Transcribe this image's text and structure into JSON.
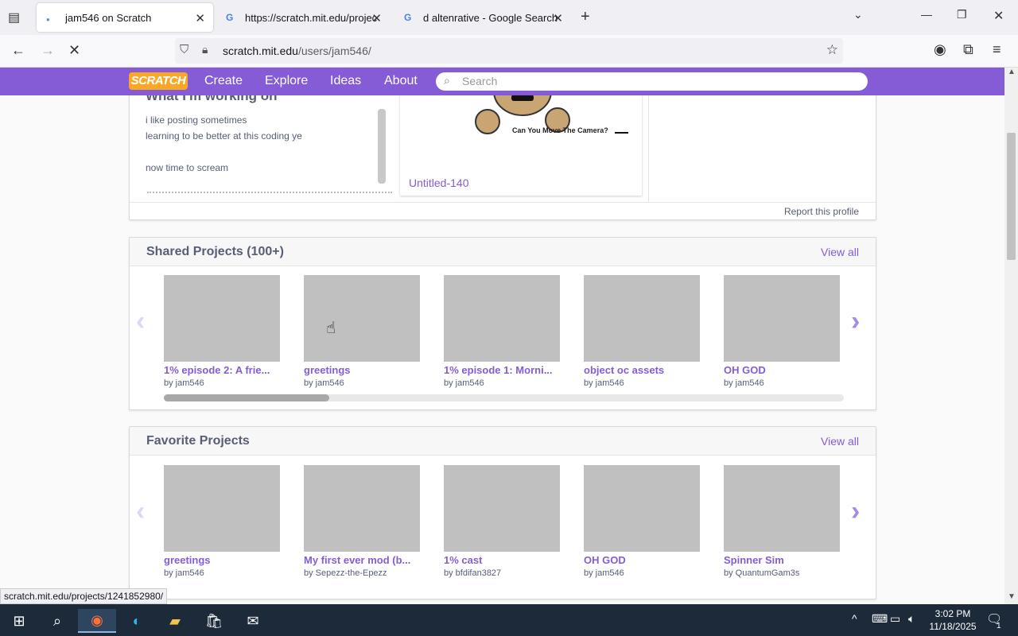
{
  "browser": {
    "tabs": [
      {
        "title": "jam546 on Scratch",
        "active": true
      },
      {
        "title": "https://scratch.mit.edu/projects",
        "active": false
      },
      {
        "title": "d altenrative - Google Search",
        "active": false
      }
    ],
    "url_host": "scratch.mit.edu",
    "url_path": "/users/jam546/",
    "status_url": "scratch.mit.edu/projects/1241852980/"
  },
  "scratch_nav": {
    "logo": "SCRATCH",
    "links": [
      "Create",
      "Explore",
      "Ideas",
      "About"
    ],
    "search_placeholder": "Search"
  },
  "working_on": {
    "heading": "What I'm working on",
    "lines": [
      "i like posting sometimes",
      "learning to be better at this coding ye",
      "",
      "now time to scream"
    ],
    "featured_caption": "Can You Move The Camera?",
    "featured_title": "Untitled-140",
    "report": "Report this profile"
  },
  "shared": {
    "title": "Shared Projects (100+)",
    "view_all": "View all",
    "projects": [
      {
        "title": "1% episode 2: A frie...",
        "by": "by jam546"
      },
      {
        "title": "greetings",
        "by": "by jam546"
      },
      {
        "title": "1% episode 1: Morni...",
        "by": "by jam546"
      },
      {
        "title": "object oc assets",
        "by": "by jam546"
      },
      {
        "title": "OH GOD",
        "by": "by jam546"
      }
    ]
  },
  "favorites": {
    "title": "Favorite Projects",
    "view_all": "View all",
    "projects": [
      {
        "title": "greetings",
        "by": "by jam546"
      },
      {
        "title": "My first ever mod (b...",
        "by": "by Sepezz-the-Epezz"
      },
      {
        "title": "1% cast",
        "by": "by bfdifan3827"
      },
      {
        "title": "OH GOD",
        "by": "by jam546"
      },
      {
        "title": "Spinner Sim",
        "by": "by QuantumGam3s"
      }
    ]
  },
  "taskbar": {
    "time": "3:02 PM",
    "date": "11/18/2025",
    "notification_count": "1"
  },
  "colors": {
    "scratch_purple": "#855cd6",
    "logo_orange": "#f9a825",
    "taskbar": "#1c2a3a"
  }
}
